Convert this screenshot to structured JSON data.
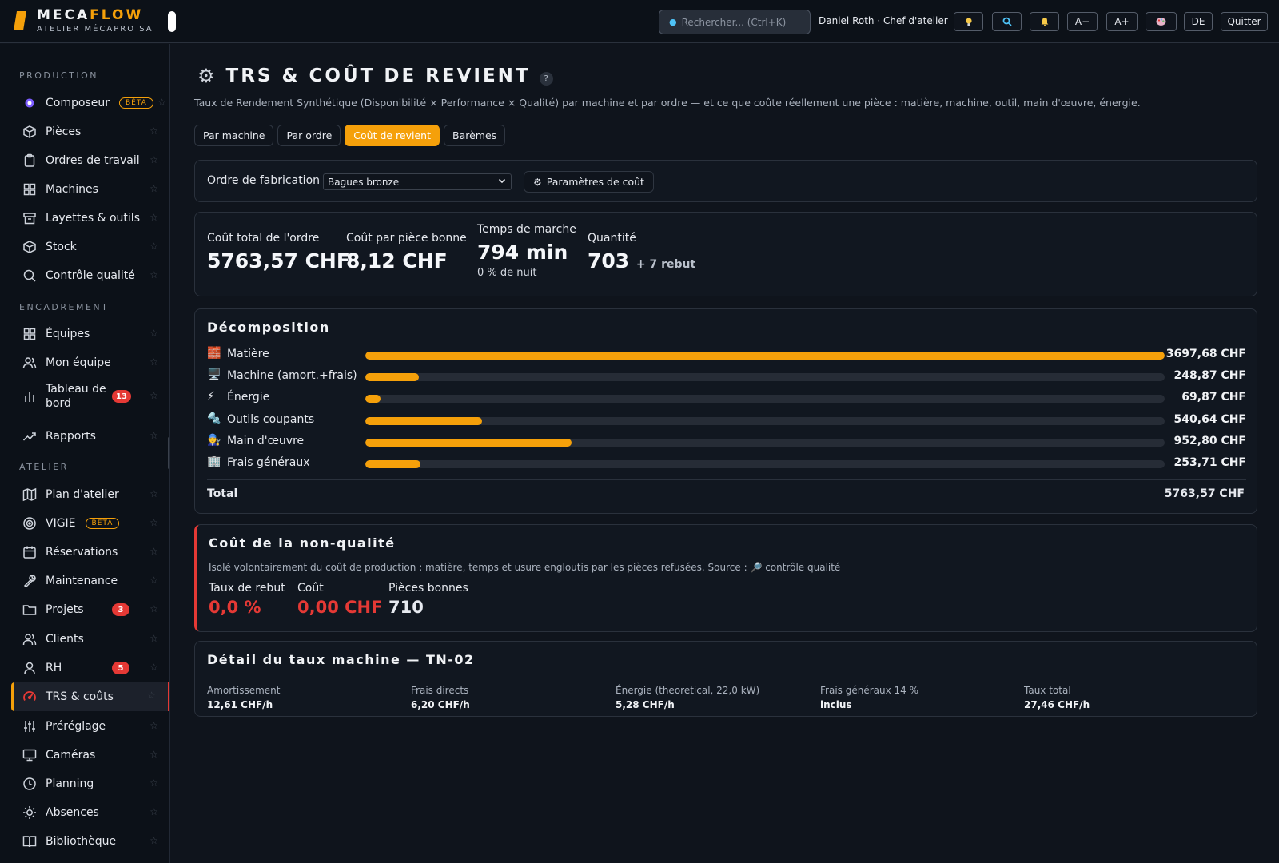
{
  "topbar": {
    "brand_main": "MECA",
    "brand_accent": "FLOW",
    "brand_sub": "ATELIER MÉCAPRO SA",
    "search_placeholder": "Rechercher...  (Ctrl+K)",
    "user": "Daniel Roth · Chef d'atelier",
    "icons": [
      "lightbulb-icon",
      "search-icon",
      "bell-icon"
    ],
    "font_smaller": "A−",
    "font_larger": "A+",
    "theme_icon": "palette-icon",
    "language": "DE",
    "quit": "Quitter"
  },
  "sidebar": {
    "sections": {
      "production": "PRODUCTION",
      "encadrement": "ENCADREMENT",
      "atelier": "ATELIER"
    },
    "items": [
      {
        "label": "Composeur",
        "icon": "sparkle-icon",
        "badge": "BÊTA"
      },
      {
        "label": "Pièces",
        "icon": "box-icon"
      },
      {
        "label": "Ordres de travail",
        "icon": "clipboard-icon"
      },
      {
        "label": "Machines",
        "icon": "grid-icon"
      },
      {
        "label": "Layettes & outils",
        "icon": "archive-icon"
      },
      {
        "label": "Stock",
        "icon": "box-icon"
      },
      {
        "label": "Contrôle qualité",
        "icon": "search-icon"
      },
      {
        "label": "Équipes",
        "icon": "grid-icon"
      },
      {
        "label": "Mon équipe",
        "icon": "users-icon"
      },
      {
        "label": "Tableau de bord",
        "icon": "bar-chart-icon",
        "count": "13"
      },
      {
        "label": "Rapports",
        "icon": "trending-up-icon"
      },
      {
        "label": "Plan d'atelier",
        "icon": "map-icon"
      },
      {
        "label": "VIGIE",
        "icon": "radar-icon",
        "badge": "BÊTA"
      },
      {
        "label": "Réservations",
        "icon": "calendar-icon"
      },
      {
        "label": "Maintenance",
        "icon": "wrench-icon"
      },
      {
        "label": "Projets",
        "icon": "folder-icon",
        "count": "3"
      },
      {
        "label": "Clients",
        "icon": "users-icon"
      },
      {
        "label": "RH",
        "icon": "user-icon",
        "count": "5"
      },
      {
        "label": "TRS & coûts",
        "icon": "gauge-icon",
        "active": true
      },
      {
        "label": "Préréglage",
        "icon": "sliders-icon"
      },
      {
        "label": "Caméras",
        "icon": "monitor-icon"
      },
      {
        "label": "Planning",
        "icon": "clock-icon"
      },
      {
        "label": "Absences",
        "icon": "sun-icon"
      },
      {
        "label": "Bibliothèque",
        "icon": "book-icon"
      }
    ]
  },
  "page": {
    "title": "TRS & COÛT DE REVIENT",
    "title_icon": "gear-icon",
    "help": "?",
    "subtitle": "Taux de Rendement Synthétique (Disponibilité × Performance × Qualité) par machine et par ordre — et ce que coûte réellement une pièce : matière, machine, outil, main d'œuvre, énergie.",
    "tabs": [
      "Par machine",
      "Par ordre",
      "Coût de revient",
      "Barèmes"
    ],
    "active_tab": "Coût de revient"
  },
  "order": {
    "label": "Ordre de fabrication",
    "selected": "Bagues bronze",
    "params_button": "Paramètres de coût"
  },
  "kpis": {
    "total_label": "Coût total de l'ordre",
    "total_value": "5763,57 CHF",
    "per_piece_label": "Coût par pièce bonne",
    "per_piece_value": "8,12 CHF",
    "runtime_label": "Temps de marche",
    "runtime_value": "794 min",
    "runtime_note": "0 % de nuit",
    "qty_label": "Quantité",
    "qty_value": "703",
    "qty_extra": "+ 7 rebut"
  },
  "decomposition": {
    "title": "Décomposition",
    "rows": [
      {
        "emoji": "🧱",
        "label": "Matière",
        "value": "3697,68 CHF",
        "fraction": 1.0
      },
      {
        "emoji": "🖥️",
        "label": "Machine (amort.+frais)",
        "value": "248,87 CHF",
        "fraction": 0.0673
      },
      {
        "emoji": "⚡",
        "label": "Énergie",
        "value": "69,87 CHF",
        "fraction": 0.0189
      },
      {
        "emoji": "🔩",
        "label": "Outils coupants",
        "value": "540,64 CHF",
        "fraction": 0.1462
      },
      {
        "emoji": "🧑‍🔧",
        "label": "Main d'œuvre",
        "value": "952,80 CHF",
        "fraction": 0.2577
      },
      {
        "emoji": "🏢",
        "label": "Frais généraux",
        "value": "253,71 CHF",
        "fraction": 0.0686
      }
    ],
    "total_label": "Total",
    "total_value": "5763,57 CHF"
  },
  "non_quality": {
    "title": "Coût de la non-qualité",
    "description": "Isolé volontairement du coût de production : matière, temps et usure engloutis par les pièces refusées. Source : 🔎 contrôle qualité",
    "scrap_rate_label": "Taux de rebut",
    "scrap_rate_value": "0,0 %",
    "cost_label": "Coût",
    "cost_value": "0,00 CHF",
    "good_label": "Pièces bonnes",
    "good_value": "710"
  },
  "machine_rate": {
    "title": "Détail du taux machine — TN-02",
    "items": [
      {
        "label": "Amortissement",
        "value": "12,61 CHF/h"
      },
      {
        "label": "Frais directs",
        "value": "6,20 CHF/h"
      },
      {
        "label": "Énergie (theoretical, 22,0 kW)",
        "value": "5,28 CHF/h"
      },
      {
        "label": "Frais généraux 14 %",
        "value": "inclus"
      },
      {
        "label": "Taux total",
        "value": "27,46 CHF/h"
      }
    ]
  },
  "colors": {
    "accent": "#f5a00a",
    "danger": "#e53935",
    "background": "#0f141c"
  }
}
